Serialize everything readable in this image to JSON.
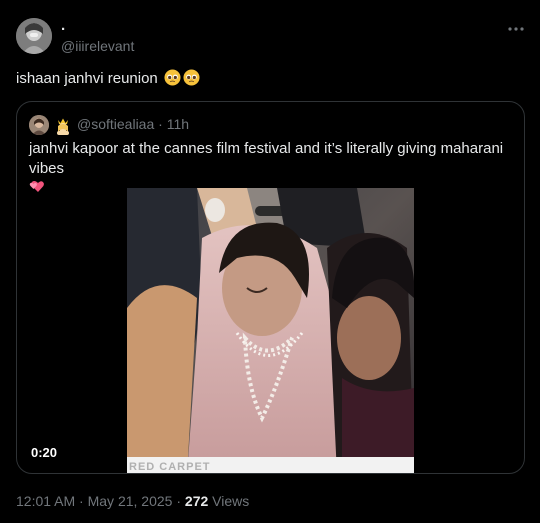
{
  "author": {
    "display_name": "·",
    "handle": "@iiirelevant"
  },
  "tweet": {
    "text": "ishaan janhvi reunion",
    "emojis": [
      "pleading-face-emoji",
      "pleading-face-emoji"
    ]
  },
  "quoted_tweet": {
    "handle": "@softiealiaa",
    "separator": "·",
    "time": "11h",
    "text": "janhvi kapoor at the cannes film festival and it’s literally giving maharani vibes",
    "emoji": "two-hearts-emoji",
    "video": {
      "duration": "0:20",
      "caption_overlay": "RED CARPET"
    }
  },
  "footer": {
    "time": "12:01 AM",
    "separator": "·",
    "date": "May 21, 2025",
    "separator2": "·",
    "views_count": "272",
    "views_label": "Views"
  },
  "colors": {
    "background": "#000000",
    "primary_text": "#e7e9ea",
    "secondary_text": "#71767b",
    "border": "#2f3336"
  }
}
